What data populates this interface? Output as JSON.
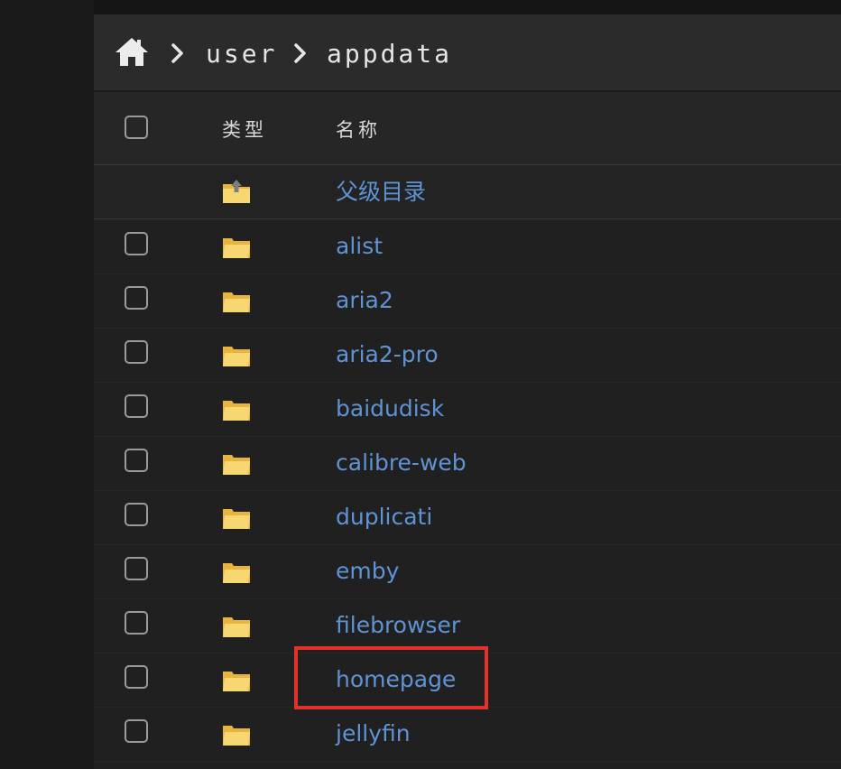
{
  "breadcrumb": {
    "home_icon": "home-icon",
    "items": [
      "user",
      "appdata"
    ]
  },
  "table": {
    "headers": {
      "type": "类型",
      "name": "名称"
    },
    "parent_row": {
      "label": "父级目录",
      "icon": "parent-folder-icon"
    },
    "rows": [
      {
        "name": "alist"
      },
      {
        "name": "aria2"
      },
      {
        "name": "aria2-pro"
      },
      {
        "name": "baidudisk"
      },
      {
        "name": "calibre-web"
      },
      {
        "name": "duplicati"
      },
      {
        "name": "emby"
      },
      {
        "name": "filebrowser"
      },
      {
        "name": "homepage",
        "highlighted": true
      },
      {
        "name": "jellyfin"
      }
    ]
  },
  "colors": {
    "link": "#5f93d4",
    "highlight": "#e5312b",
    "folder": "#f3c84a"
  }
}
